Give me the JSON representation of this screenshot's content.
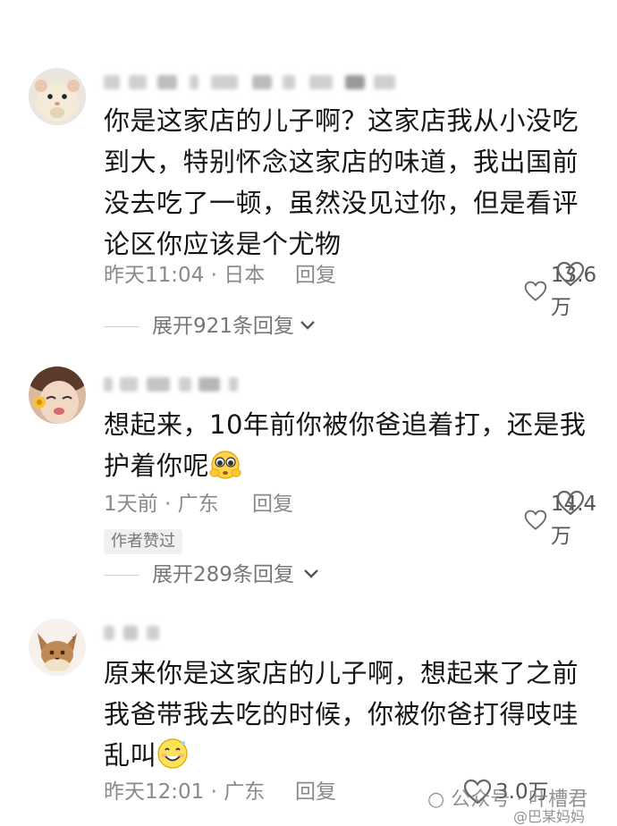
{
  "comments": [
    {
      "text": "你是这家店的儿子啊？这家店我从小没吃到大，特别怀念这家店的味道，我出国前没去吃了一顿，虽然没见过你，但是看评论区你应该是个尤物",
      "time": "昨天11:04 · 日本",
      "reply": "回复",
      "likes": "13.6万",
      "expand": "展开921条回复",
      "avatar_icon": "hamster-avatar-icon"
    },
    {
      "text": "想起来，10年前你被你爸追着打，还是我护着你呢",
      "emoji_icon": "pleading-face-emoji-icon",
      "time": "1天前 · 广东",
      "reply": "回复",
      "likes": "14.4万",
      "badge": "作者赞过",
      "expand": "展开289条回复",
      "avatar_icon": "girl-avatar-icon"
    },
    {
      "text": "原来你是这家店的儿子啊，想起来了之前我爸带我去吃的时候，你被你爸打得吱哇乱叫",
      "emoji_icon": "smiling-face-emoji-icon",
      "time": "昨天12:01 · 广东",
      "reply": "回复",
      "likes": "3.0万",
      "avatar_icon": "eevee-avatar-icon"
    }
  ],
  "watermark": {
    "left": "公众号 · 叶槽君",
    "right": "@巴某妈妈"
  }
}
